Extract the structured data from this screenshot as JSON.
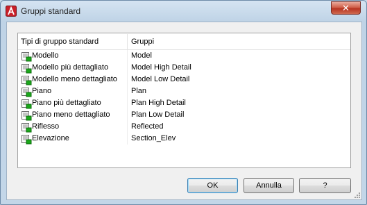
{
  "window": {
    "title": "Gruppi standard",
    "close_label": "✕",
    "app_icon": "autocad-icon"
  },
  "list": {
    "columns": [
      "Tipi di gruppo standard",
      "Gruppi"
    ],
    "rows": [
      {
        "type": "Modello",
        "group": "Model"
      },
      {
        "type": "Modello più dettagliato",
        "group": "Model High Detail"
      },
      {
        "type": "Modello meno dettagliato",
        "group": "Model Low Detail"
      },
      {
        "type": "Piano",
        "group": "Plan"
      },
      {
        "type": "Piano più dettagliato",
        "group": "Plan High Detail"
      },
      {
        "type": "Piano meno dettagliato",
        "group": "Plan Low Detail"
      },
      {
        "type": "Riflesso",
        "group": "Reflected"
      },
      {
        "type": "Elevazione",
        "group": "Section_Elev"
      }
    ],
    "row_icon": "display-group-icon"
  },
  "buttons": {
    "ok": "OK",
    "cancel": "Annulla",
    "help": "?"
  },
  "colors": {
    "accent_green": "#1aa81a",
    "app_red": "#c8202a"
  }
}
